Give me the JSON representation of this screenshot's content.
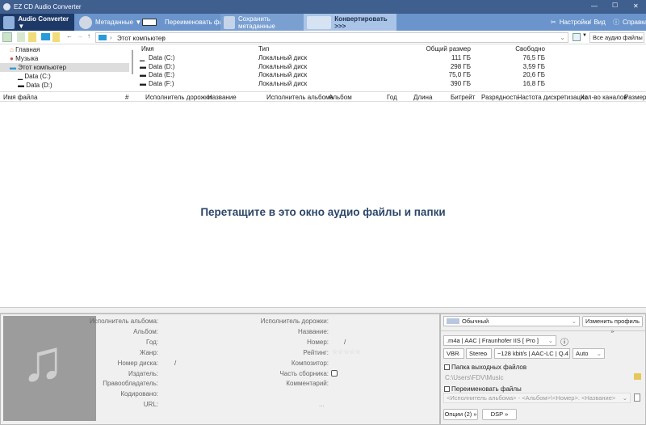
{
  "window": {
    "title": "EZ CD Audio Converter",
    "controls": [
      "—",
      "☐",
      "✕"
    ]
  },
  "toolbar": {
    "audio_converter": "Audio Converter ▼",
    "metadata": "Метаданные ▼",
    "rename": "Переименовать файлы",
    "save_meta": "Сохранить метаданные",
    "convert": "Конвертировать >>>",
    "settings": "Настройки",
    "view": "Вид",
    "help": "Справка"
  },
  "address": {
    "path": "Этот компьютер",
    "filter": "Все аудио файлы"
  },
  "tree": [
    "Главная",
    "Музыка",
    "Этот компьютер",
    "Data (C:)",
    "Data (D:)"
  ],
  "drives": {
    "headers": [
      "Имя",
      "Тип",
      "Общий размер",
      "Свободно"
    ],
    "rows": [
      [
        "Data (C:)",
        "Локальный диск",
        "111 ГБ",
        "76,5 ГБ"
      ],
      [
        "Data (D:)",
        "Локальный диск",
        "298 ГБ",
        "3,59 ГБ"
      ],
      [
        "Data (E:)",
        "Локальный диск",
        "75,0 ГБ",
        "20,6 ГБ"
      ],
      [
        "Data (F:)",
        "Локальный диск",
        "390 ГБ",
        "16,8 ГБ"
      ]
    ]
  },
  "columns": [
    "Имя файла",
    "#",
    "Исполнитель дорожки",
    "Название",
    "Исполнитель альбома",
    "Альбом",
    "Год",
    "Длина",
    "Битрейт",
    "Разрядность",
    "Частота дискретизации",
    "Кол-во каналов",
    "Размер"
  ],
  "drop_hint": "Перетащите в это окно аудио файлы и папки",
  "meta_left": [
    "Исполнитель альбома:",
    "Альбом:",
    "Год:",
    "Жанр:",
    "Номер диска:",
    "Издатель:",
    "Правообладатель:",
    "Кодировано:",
    "URL:"
  ],
  "meta_right": [
    "Исполнитель дорожки:",
    "Название:",
    "Номер:",
    "Рейтинг:",
    "Композитор:",
    "Часть сборника:",
    "Комментарий:"
  ],
  "disc_sep": "/",
  "track_sep": "/",
  "rating_stars": "☆☆☆☆☆",
  "ellipsis": "...",
  "profile": {
    "name": "Обычный",
    "change": "Изменить профиль »",
    "format": ".m4a | AAC | Fraunhofer IIS [ Pro ]",
    "mode": "VBR",
    "channels": "Stereo",
    "quality": "~128 kbit/s | AAC-LC | Q 4",
    "rate": "Auto",
    "out_folder_label": "Папка выходных файлов",
    "out_folder": "C:\\Users\\FDV\\Music",
    "rename_label": "Переименовать файлы",
    "rename_pattern": "<Исполнитель альбома> - <Альбом>\\<Номер>. <Название>",
    "options": "Опции (2) »",
    "dsp": "DSP »"
  }
}
